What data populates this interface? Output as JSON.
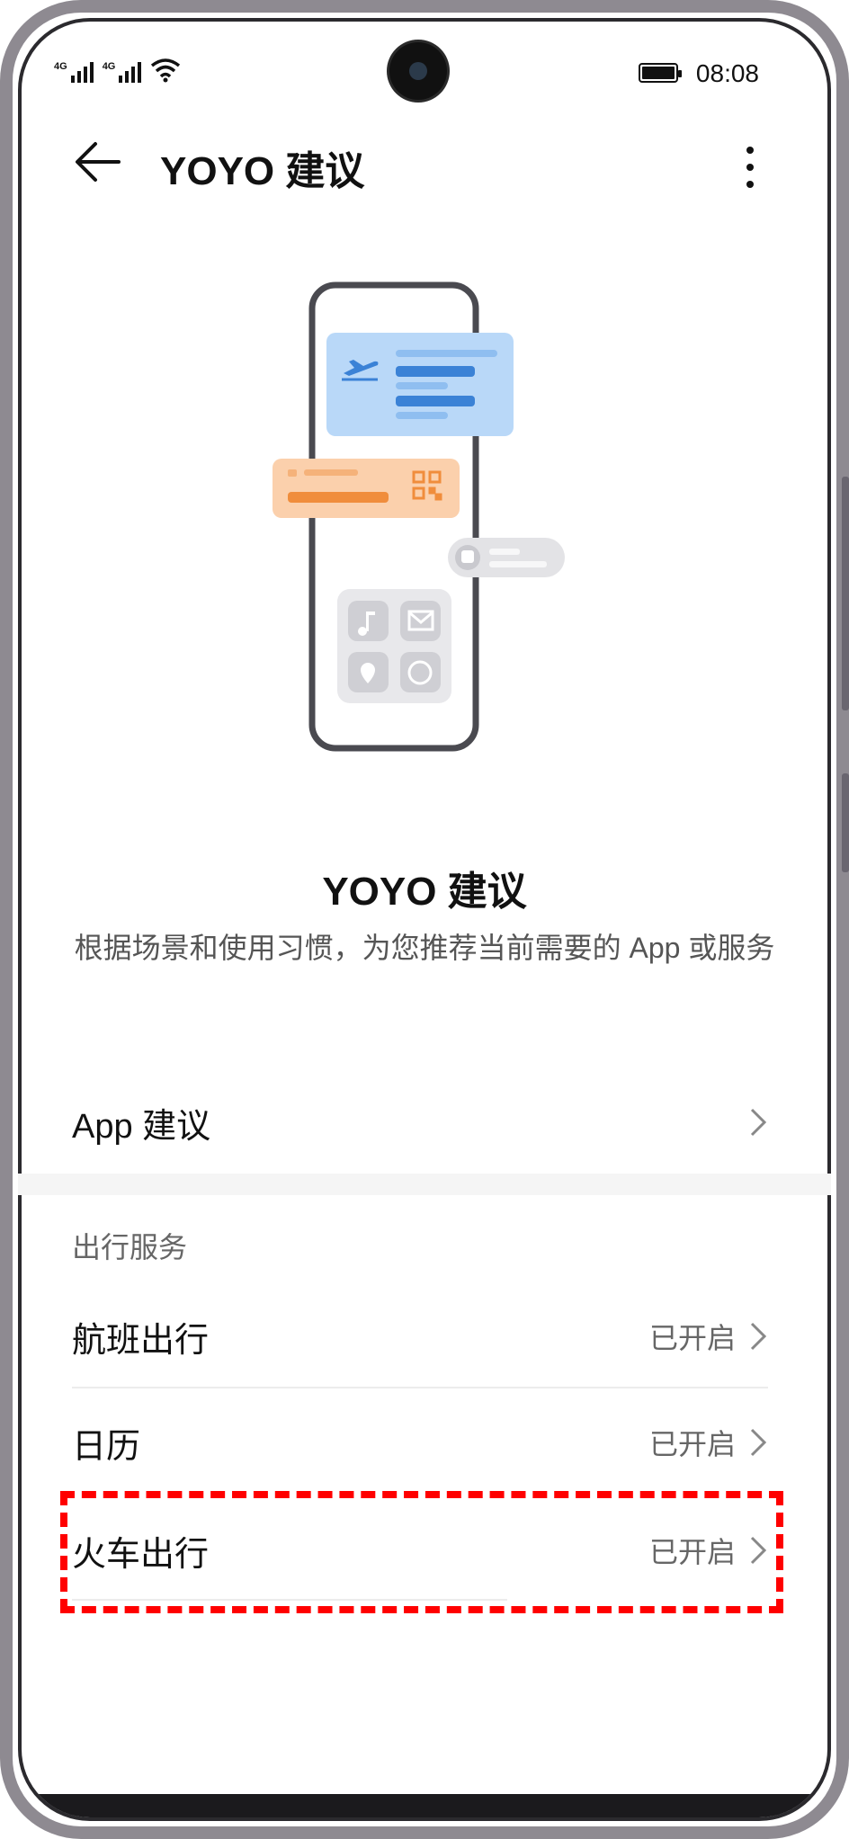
{
  "status_bar": {
    "time": "08:08",
    "signal_tag_1": "4G",
    "signal_tag_2": "4G"
  },
  "header": {
    "title": "YOYO 建议"
  },
  "hero": {
    "title": "YOYO 建议",
    "description": "根据场景和使用习惯，为您推荐当前需要的 App 或服务"
  },
  "rows": {
    "app_suggest": {
      "label": "App 建议"
    },
    "section_title": "出行服务",
    "flight": {
      "label": "航班出行",
      "status": "已开启"
    },
    "calendar": {
      "label": "日历",
      "status": "已开启"
    },
    "train": {
      "label": "火车出行",
      "status": "已开启"
    }
  },
  "colors": {
    "highlight": "#ff0000",
    "ticket_blue": "#b9d8f8",
    "ticket_orange": "#fbd0ac"
  }
}
